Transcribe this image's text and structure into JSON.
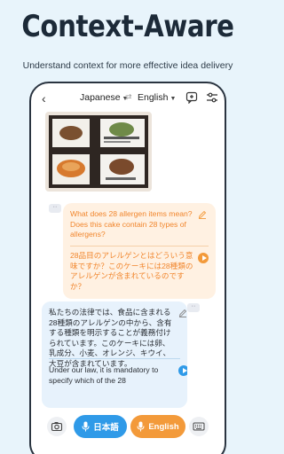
{
  "promo": {
    "headline": "Context-Aware",
    "subline": "Understand context for more effective idea delivery"
  },
  "topbar": {
    "source_language": "Japanese",
    "target_language": "English"
  },
  "conversation": {
    "question_en": "What does 28 allergen items mean? Does this cake contain 28 types of allergens?",
    "question_ja": "28品目のアレルゲンとはどういう意味ですか？このケーキには28種類のアレルゲンが含まれているのですか？",
    "reply_ja": "私たちの法律では、食品に含まれる28種類のアレルゲンの中から、含有する種類を明示することが義務付けられています。このケーキには卵、乳成分、小麦、オレンジ、キウイ、大豆が含まれています。",
    "reply_en": "Under our law, it is mandatory to specify which of the 28"
  },
  "bottombar": {
    "ja_button": "日本語",
    "en_button": "English"
  },
  "colors": {
    "accent_orange": "#f39a3a",
    "accent_blue": "#2f9ae8",
    "background": "#e8f4fb"
  },
  "icons": [
    "back-arrow-icon",
    "swap-icon",
    "note-icon",
    "tune-icon",
    "edit-icon",
    "play-icon",
    "camera-icon",
    "mic-icon",
    "keyboard-icon"
  ]
}
